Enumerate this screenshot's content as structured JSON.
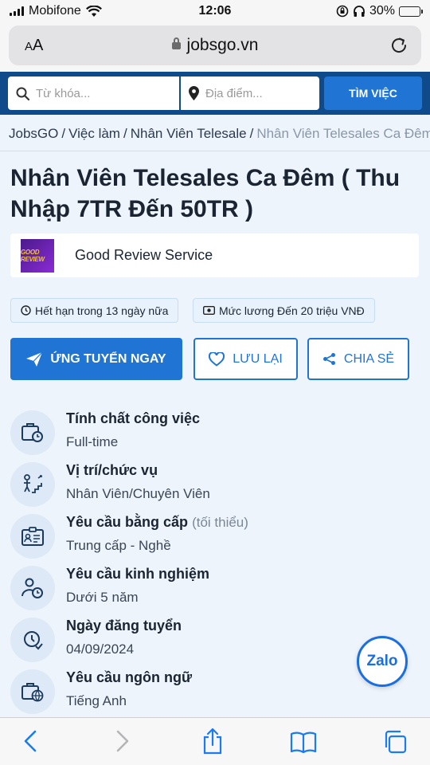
{
  "status_bar": {
    "carrier": "Mobifone",
    "time": "12:06",
    "battery": "30%",
    "battery_level": 0.3
  },
  "browser": {
    "aa_label_big": "A",
    "aa_label_small": "A",
    "url": "jobsgo.vn",
    "icons": [
      "lock-icon",
      "reload-icon"
    ]
  },
  "search": {
    "keyword_placeholder": "Từ khóa...",
    "location_placeholder": "Địa điểm...",
    "button_label": "TÌM VIỆC"
  },
  "breadcrumb": {
    "items": [
      "JobsGO",
      "Việc làm",
      "Nhân Viên Telesale"
    ],
    "separator": "/",
    "current": "Nhân Viên Telesales Ca Đêm"
  },
  "job": {
    "title": "Nhân Viên Telesales Ca Đêm ( Thu Nhập 7TR Đến 50TR )",
    "company": "Good Review Service",
    "logo_text": "GOOD REVIEW",
    "deadline_badge": "Hết hạn trong 13 ngày nữa",
    "salary_badge": "Mức lương Đến 20 triệu VNĐ"
  },
  "actions": {
    "apply_label": "ỨNG TUYỂN NGAY",
    "save_label": "LƯU LẠI",
    "share_label": "CHIA SẺ"
  },
  "details": [
    {
      "label": "Tính chất công việc",
      "sub": "",
      "value": "Full-time",
      "icon": "job-type-icon"
    },
    {
      "label": "Vị trí/chức vụ",
      "sub": "",
      "value": "Nhân Viên/Chuyên Viên",
      "icon": "position-icon"
    },
    {
      "label": "Yêu cầu bằng cấp",
      "sub": "(tối thiểu)",
      "value": "Trung cấp - Nghề",
      "icon": "degree-icon"
    },
    {
      "label": "Yêu cầu kinh nghiệm",
      "sub": "",
      "value": "Dưới 5 năm",
      "icon": "experience-icon"
    },
    {
      "label": "Ngày đăng tuyển",
      "sub": "",
      "value": "04/09/2024",
      "icon": "calendar-icon"
    },
    {
      "label": "Yêu cầu ngôn ngữ",
      "sub": "",
      "value": "Tiếng Anh",
      "icon": "language-icon"
    }
  ],
  "zalo": {
    "label": "Zalo"
  },
  "colors": {
    "header": "#0f4a8a",
    "primary": "#1f74d4",
    "page_bg": "#eef4fb",
    "icon_circle": "#dde9f6"
  }
}
